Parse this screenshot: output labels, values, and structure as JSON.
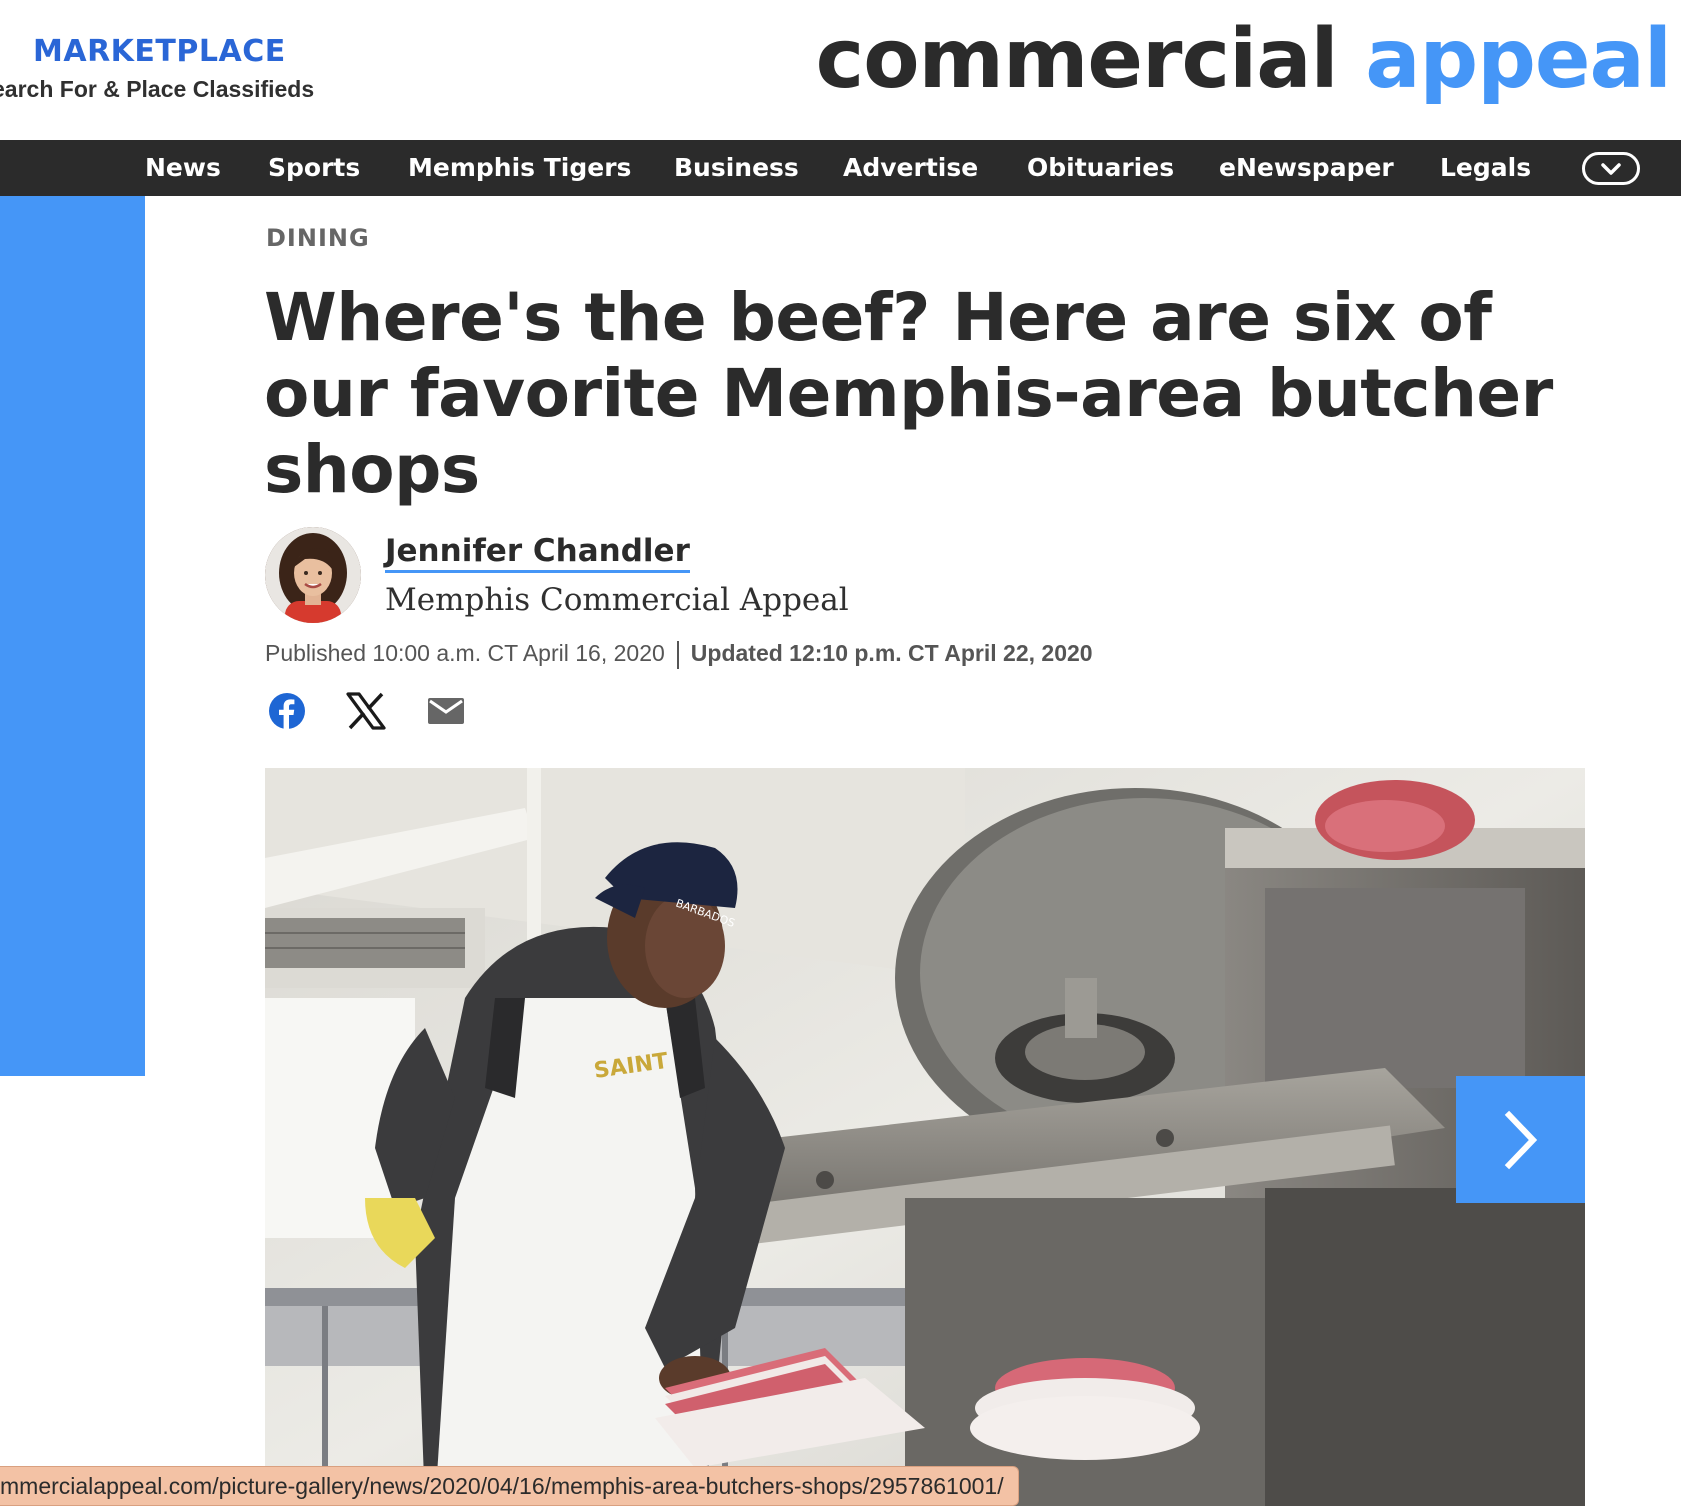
{
  "header": {
    "marketplace_title": "MARKETPLACE",
    "marketplace_sub": "earch For & Place Classifieds",
    "brand_part1": "commercial",
    "brand_part2": "appeal"
  },
  "nav": {
    "items": [
      "News",
      "Sports",
      "Memphis Tigers",
      "Business",
      "Advertise",
      "Obituaries",
      "eNewspaper",
      "Legals"
    ]
  },
  "article": {
    "section": "DINING",
    "headline": "Where's the beef? Here are six of our favorite Memphis-area butcher shops",
    "author_name": "Jennifer Chandler",
    "author_org": "Memphis Commercial Appeal",
    "published": "Published 10:00 a.m. CT April 16, 2020",
    "updated": "Updated 12:10 p.m. CT April 22, 2020",
    "photo_cap_text": "BARBADOS"
  },
  "share": {
    "icons": [
      "facebook-icon",
      "x-icon",
      "email-icon"
    ]
  },
  "status_bar": {
    "url": "mmercialappeal.com/picture-gallery/news/2020/04/16/memphis-area-butchers-shops/2957861001/"
  },
  "colors": {
    "accent_blue": "#4596f7",
    "nav_bg": "#2b2b2b",
    "status_bg": "#f3c2a5"
  }
}
